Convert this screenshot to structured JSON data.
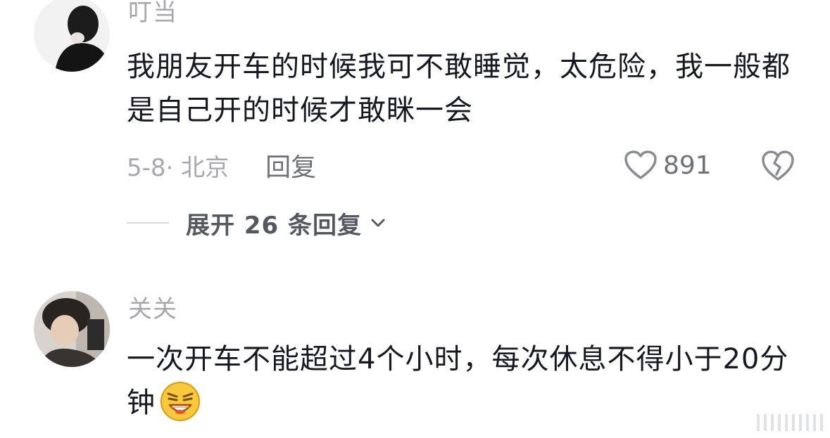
{
  "comments": [
    {
      "username": "叮当",
      "text": "我朋友开车的时候我可不敢睡觉，太危险，我一般都是自己开的时候才敢眯一会",
      "date_location": "5-8· 北京",
      "reply_label": "回复",
      "likes": "891",
      "expand_label": "展开 26 条回复"
    },
    {
      "username": "关关",
      "text": "一次开车不能超过4个小时，每次休息不得小于20分钟"
    }
  ],
  "icons": {
    "like": "heart-outline-icon",
    "dislike": "broken-heart-icon",
    "expand": "chevron-down-icon",
    "emoji": "grimacing-laugh-emoji"
  },
  "colors": {
    "text": "#161823",
    "muted": "#a6a8ae",
    "secondary": "#6f7179"
  }
}
